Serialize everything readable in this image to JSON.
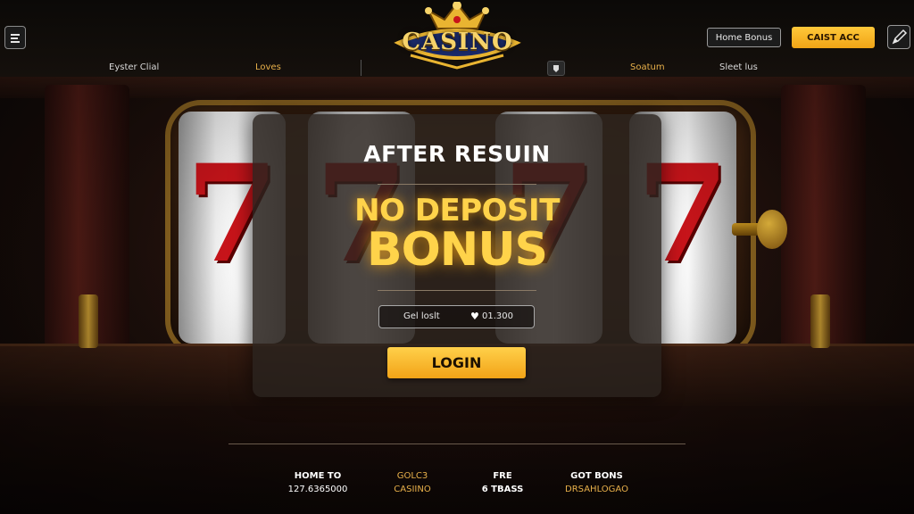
{
  "header": {
    "logo_text": "CASINO",
    "home_bonus_label": "Home Bonus",
    "cta_label": "CAIST ACC"
  },
  "nav": {
    "items": [
      "Eyster Clial",
      "Loves",
      "Soatum",
      "Sleet lus"
    ]
  },
  "promo": {
    "heading": "AFTER RESUIN",
    "bonus_line1": "NO DEPOSIT",
    "bonus_line2": "BONUS",
    "field_label": "Gel loslt",
    "field_value": "01.300",
    "login_label": "LOGIN"
  },
  "footer": {
    "columns": [
      {
        "line1": "HOME TO",
        "line2": "127.6365000"
      },
      {
        "line1": "GOLC3",
        "line2": "CASIINO"
      },
      {
        "line1": "FRE",
        "line2": "6 TBASS"
      },
      {
        "line1": "GOT BONS",
        "line2": "DRSAHLOGAO"
      }
    ]
  },
  "colors": {
    "accent": "#ffc83a",
    "gold_text": "#e8b04a",
    "bonus_glow": "#ffd34a"
  },
  "icons": {
    "menu": "menu-icon",
    "edit": "pencil-icon",
    "balance": "heart-icon",
    "nav_chip": "chip-icon",
    "logo": "crown-icon"
  }
}
